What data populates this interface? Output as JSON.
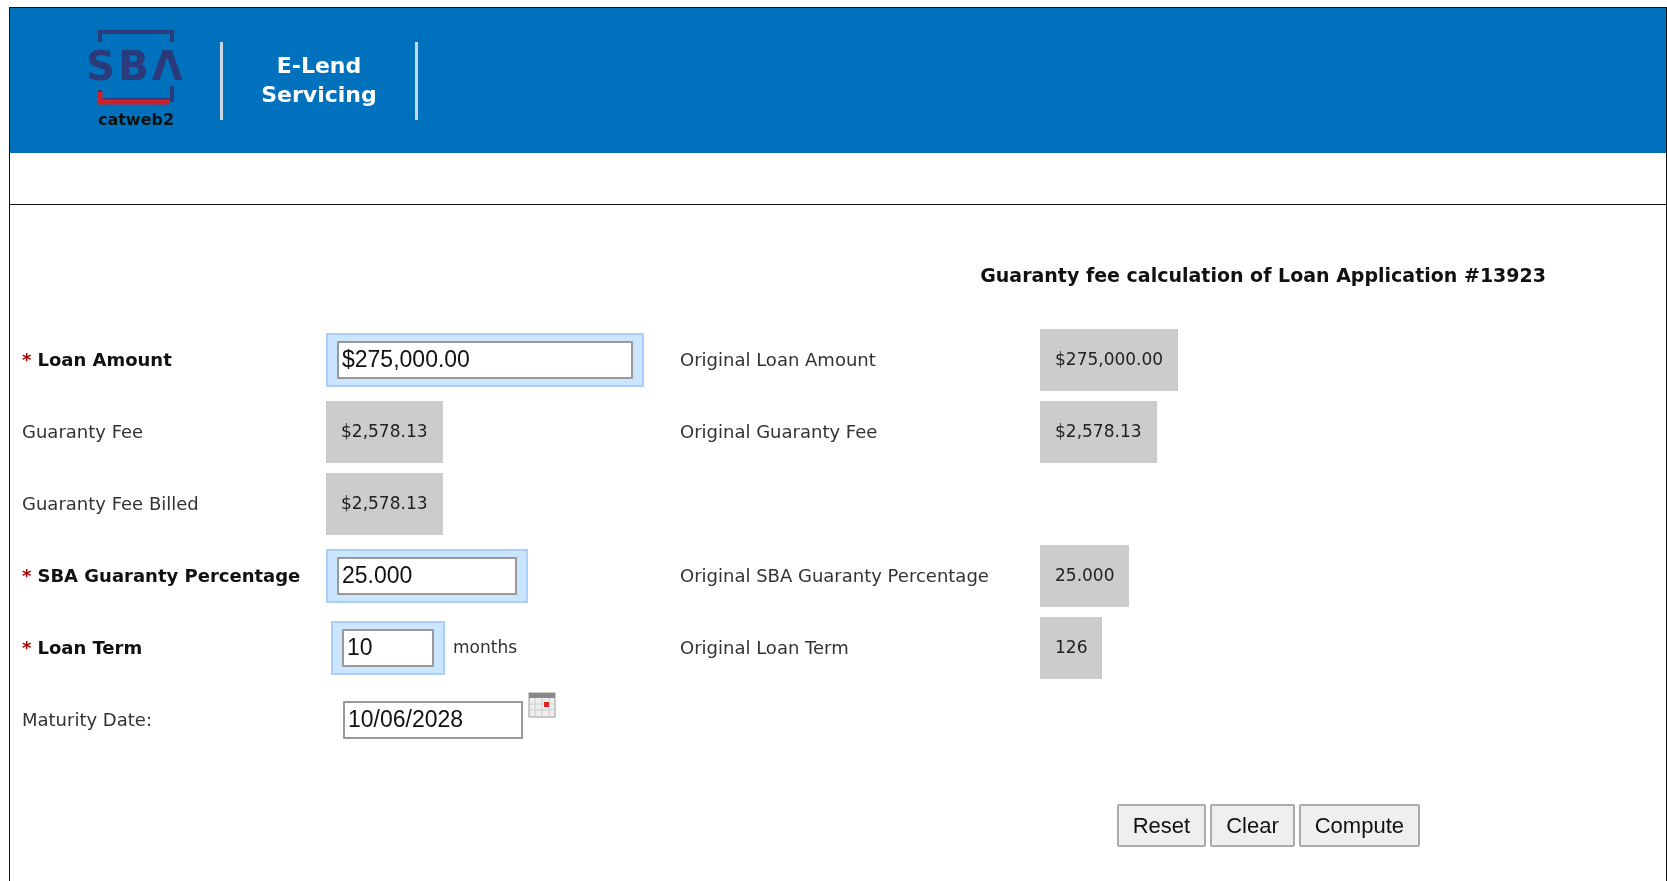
{
  "header": {
    "logo": {
      "text": "SBΛ",
      "caption": "catweb2"
    },
    "app_title": "E-Lend Servicing"
  },
  "form": {
    "title": "Guaranty fee calculation of Loan Application #13923",
    "rows": [
      {
        "label": "Loan Amount",
        "required": true,
        "mark": "*",
        "kind": "input",
        "value": "$275,000.00",
        "focused": true,
        "original_label": "Original Loan Amount",
        "original_value": "$275,000.00"
      },
      {
        "label": "Guaranty Fee",
        "required": false,
        "kind": "readonly",
        "value": "$2,578.13",
        "original_label": "Original Guaranty Fee",
        "original_value": "$2,578.13"
      },
      {
        "label": "Guaranty Fee Billed",
        "required": false,
        "kind": "readonly",
        "value": "$2,578.13"
      },
      {
        "label": "SBA Guaranty Percentage",
        "required": true,
        "mark": "*",
        "kind": "input",
        "value": "25.000",
        "focused": true,
        "original_label": "Original SBA Guaranty Percentage",
        "original_value": "25.000"
      },
      {
        "label": "Loan Term",
        "required": true,
        "mark": "*",
        "kind": "input",
        "value": "10",
        "focused": true,
        "unit": "months",
        "original_label": "Original Loan Term",
        "original_value": "126"
      },
      {
        "label": "Maturity Date:",
        "required": false,
        "kind": "date",
        "value": "10/06/2028",
        "focused": false
      }
    ],
    "buttons": [
      "Reset",
      "Clear",
      "Compute"
    ]
  }
}
